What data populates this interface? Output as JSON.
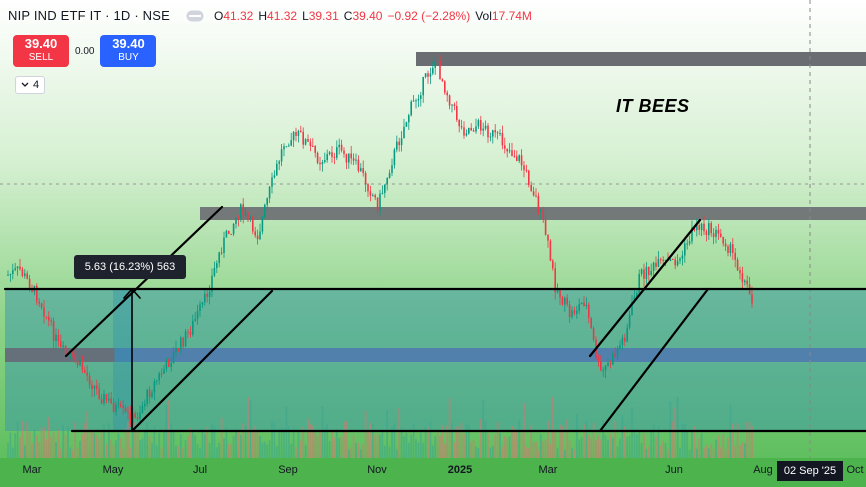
{
  "header": {
    "symbol": "NIP IND ETF IT · 1D · NSE",
    "ohlc": [
      {
        "k": "O",
        "v": "41.32"
      },
      {
        "k": "H",
        "v": "41.32"
      },
      {
        "k": "L",
        "v": "39.31"
      },
      {
        "k": "C",
        "v": "39.40"
      },
      {
        "k": "",
        "v": "−0.92 (−2.28%)"
      },
      {
        "k": "Vol",
        "v": "17.74M"
      }
    ],
    "eye_icon": "eye-icon"
  },
  "trade": {
    "sell_price": "39.40",
    "sell_label": "SELL",
    "spread": "0.00",
    "buy_price": "39.40",
    "buy_label": "BUY"
  },
  "indicators_toggle": {
    "icon": "chevron-down-icon",
    "count": "4"
  },
  "measurement_label": "5.63 (16.23%) 563",
  "annotation": "IT BEES",
  "x_axis": {
    "labels": [
      {
        "text": "Mar",
        "bold": false
      },
      {
        "text": "May",
        "bold": false
      },
      {
        "text": "Jul",
        "bold": false
      },
      {
        "text": "Sep",
        "bold": false
      },
      {
        "text": "Nov",
        "bold": false
      },
      {
        "text": "2025",
        "bold": true
      },
      {
        "text": "Mar",
        "bold": false
      },
      {
        "text": "Jun",
        "bold": false
      },
      {
        "text": "Aug",
        "bold": false
      },
      {
        "text": "Oct",
        "bold": false
      }
    ],
    "cursor_date": "02 Sep '25"
  },
  "colors": {
    "up": "#089981",
    "down": "#f23645",
    "background_green": "#7fd07f",
    "zone_teal": "#4a9ea8",
    "zone_blue": "#5a7fbf",
    "resistance_gray": "#6a6d72",
    "axis_green": "#4db34d"
  }
}
